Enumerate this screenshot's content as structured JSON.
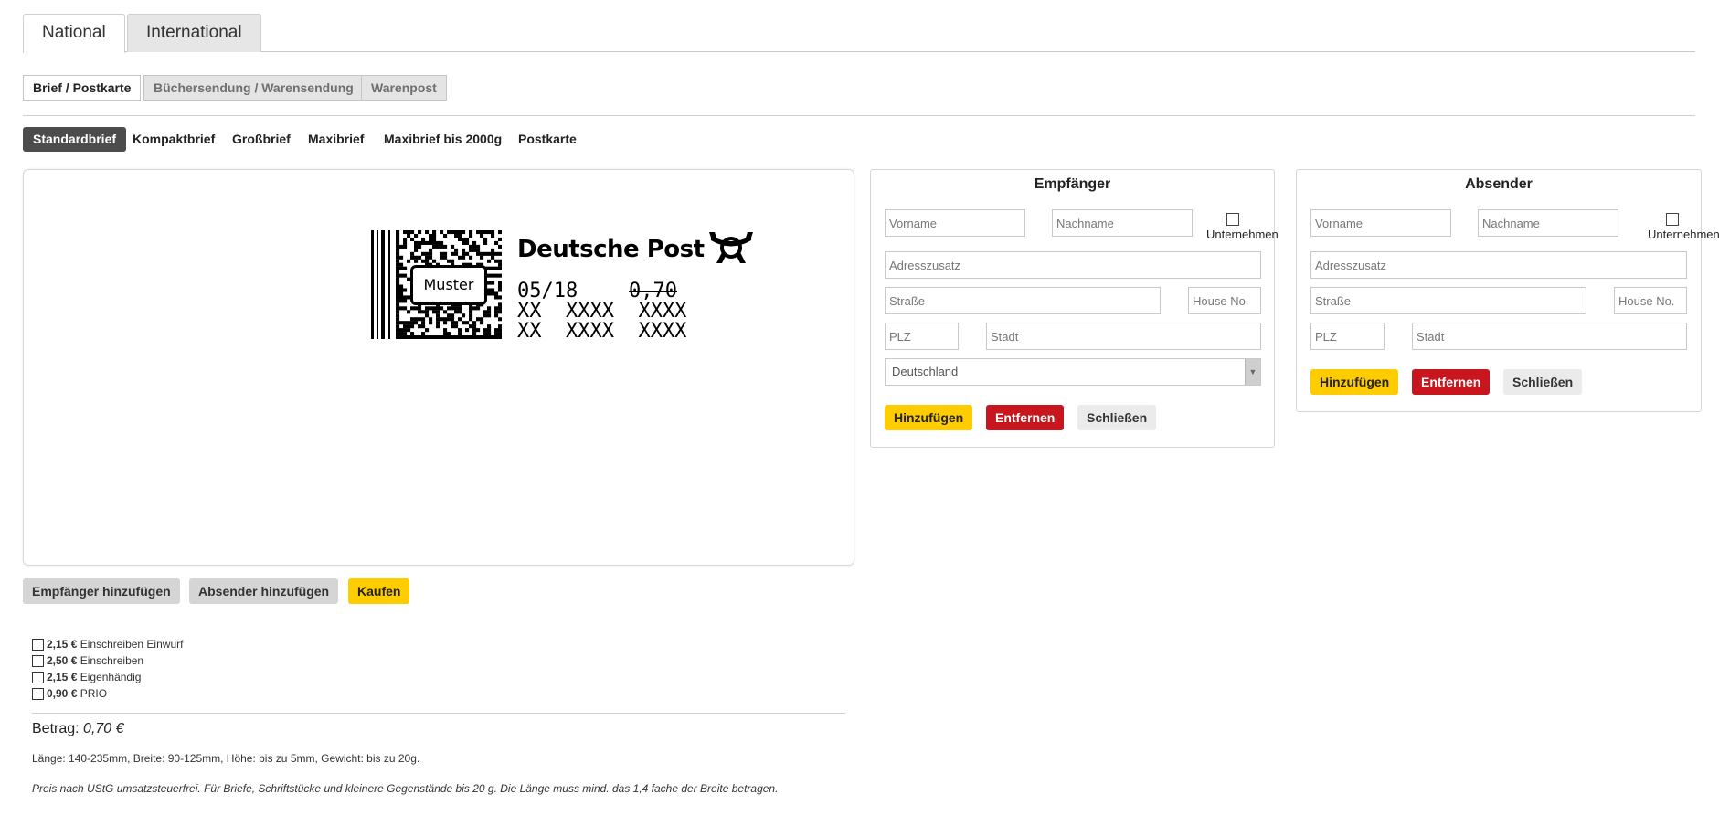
{
  "tabs": [
    {
      "label": "National",
      "active": true
    },
    {
      "label": "International",
      "active": false
    }
  ],
  "categories": [
    {
      "label": "Brief / Postkarte",
      "active": true
    },
    {
      "label": "Büchersendung / Warensendung",
      "active": false
    },
    {
      "label": "Warenpost",
      "active": false
    }
  ],
  "subtypes": [
    {
      "label": "Standardbrief",
      "active": true
    },
    {
      "label": "Kompaktbrief",
      "active": false
    },
    {
      "label": "Großbrief",
      "active": false
    },
    {
      "label": "Maxibrief",
      "active": false
    },
    {
      "label": "Maxibrief bis 2000g",
      "active": false
    },
    {
      "label": "Postkarte",
      "active": false
    }
  ],
  "stamp": {
    "brand": "Deutsche Post",
    "watermark": "Muster",
    "date": "05/18",
    "price": "0,70",
    "line2": "XX  XXXX  XXXX",
    "line3": "XX  XXXX  XXXX"
  },
  "actions": {
    "add_recipient": "Empfänger hinzufügen",
    "add_sender": "Absender hinzufügen",
    "buy": "Kaufen"
  },
  "recipient": {
    "title": "Empfänger",
    "first_name_ph": "Vorname",
    "last_name_ph": "Nachname",
    "company_label": "Unternehmen",
    "address_extra_ph": "Adresszusatz",
    "street_ph": "Straße",
    "house_no_ph": "House No.",
    "zip_ph": "PLZ",
    "city_ph": "Stadt",
    "country": "Deutschland",
    "add_label": "Hinzufügen",
    "remove_label": "Entfernen",
    "close_label": "Schließen"
  },
  "sender": {
    "title": "Absender",
    "first_name_ph": "Vorname",
    "last_name_ph": "Nachname",
    "company_label": "Unternehmen",
    "address_extra_ph": "Adresszusatz",
    "street_ph": "Straße",
    "house_no_ph": "House No.",
    "zip_ph": "PLZ",
    "city_ph": "Stadt",
    "add_label": "Hinzufügen",
    "remove_label": "Entfernen",
    "close_label": "Schließen"
  },
  "options": [
    {
      "price": "2,15 €",
      "label": "Einschreiben Einwurf",
      "checked": false
    },
    {
      "price": "2,50 €",
      "label": "Einschreiben",
      "checked": false
    },
    {
      "price": "2,15 €",
      "label": "Eigenhändig",
      "checked": false
    },
    {
      "price": "0,90 €",
      "label": "PRIO",
      "checked": false
    }
  ],
  "amount": {
    "label": "Betrag:",
    "value": "0,70 €"
  },
  "dimensions": "Länge: 140-235mm, Breite: 90-125mm, Höhe: bis zu 5mm, Gewicht: bis zu 20g.",
  "note": "Preis nach UStG umsatzsteuerfrei. Für Briefe, Schriftstücke und kleinere Gegenstände bis 20 g. Die Länge muss mind. das 1,4 fache der Breite betragen.",
  "colors": {
    "yellow": "#ffcc00",
    "red": "#c8161e",
    "dark": "#4c4c4c"
  }
}
